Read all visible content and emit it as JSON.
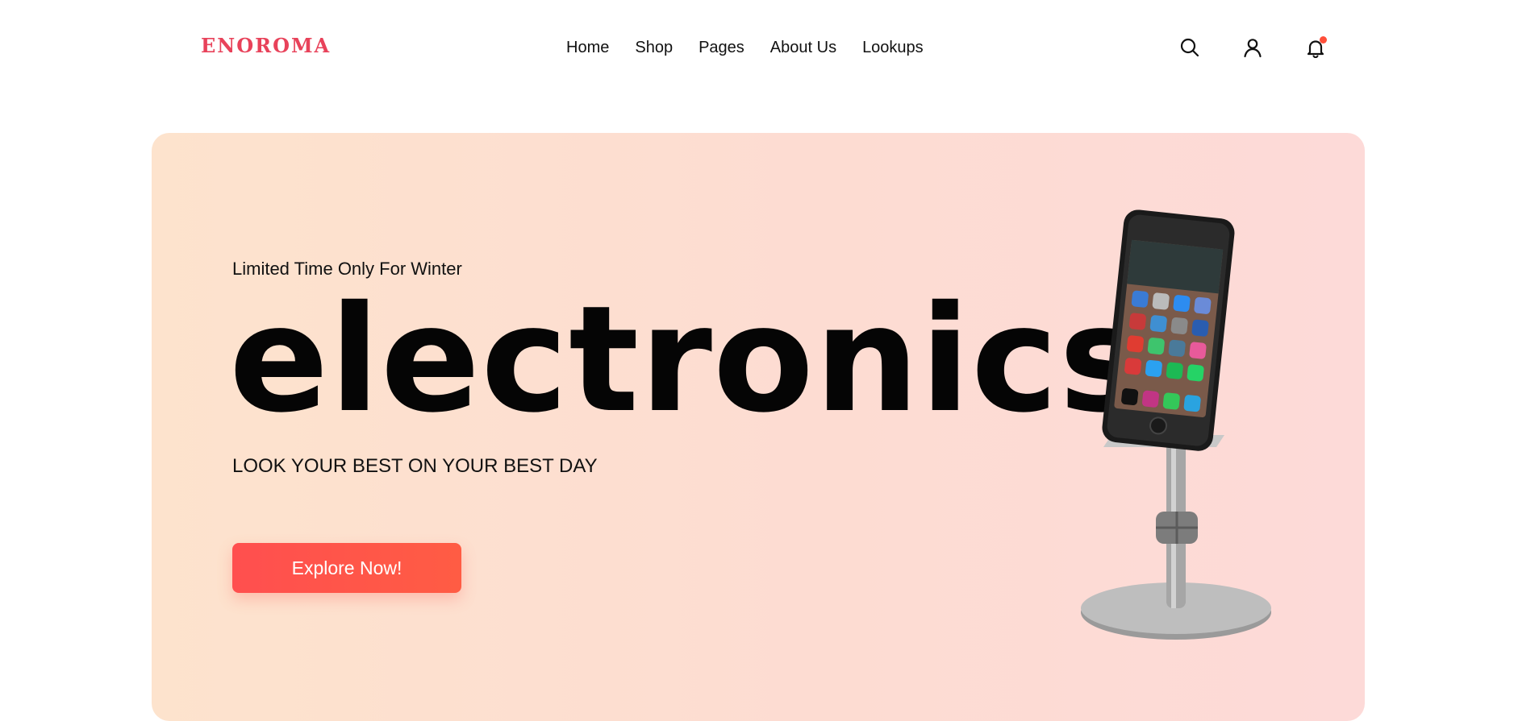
{
  "header": {
    "logo": "ENOROMA",
    "nav": [
      "Home",
      "Shop",
      "Pages",
      "About Us",
      "Lookups"
    ],
    "icons": [
      "search-icon",
      "user-icon",
      "bell-icon"
    ]
  },
  "hero": {
    "subtitle": "Limited Time Only For Winter",
    "title": "electronics",
    "tagline": "LOOK YOUR BEST ON YOUR BEST DAY",
    "cta": "Explore Now!",
    "product_image": "phone-on-stand"
  },
  "colors": {
    "accent": "#e8425a",
    "button": "#ff5b4a",
    "hero_start": "#fde3cd",
    "hero_end": "#fddad8"
  }
}
